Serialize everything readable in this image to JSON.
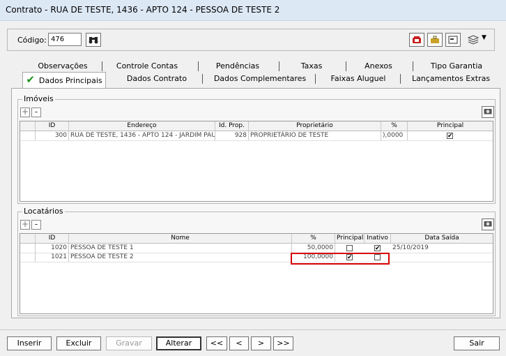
{
  "window": {
    "title": "Contrato - RUA DE TESTE, 1436 - APTO 124 - PESSOA DE TESTE 2"
  },
  "header": {
    "codigo_label": "Código:",
    "codigo_value": "476"
  },
  "tabs_row1": [
    "Observações",
    "Controle Contas",
    "Pendências",
    "Taxas",
    "Anexos",
    "Tipo Garantia"
  ],
  "tabs_row2": [
    "Dados Principais",
    "Dados Contrato",
    "Dados Complementares",
    "Faixas Aluguel",
    "Lançamentos Extras"
  ],
  "imoveis": {
    "title": "Imóveis",
    "columns": [
      "ID",
      "Endereço",
      "Id. Prop.",
      "Proprietário",
      "%",
      "Principal"
    ],
    "rows": [
      {
        "id": "300",
        "endereco": "RUA DE TESTE, 1436 - APTO 124 - JARDIM PAU",
        "id_prop": "928",
        "proprietario": "PROPRIETÁRIO DE TESTE",
        "pct": "),0000",
        "principal": true
      }
    ]
  },
  "locatarios": {
    "title": "Locatários",
    "columns": [
      "ID",
      "Nome",
      "%",
      "Principal",
      "Inativo",
      "Data Saída"
    ],
    "rows": [
      {
        "id": "1020",
        "nome": "PESSOA DE TESTE 1",
        "pct": "50,0000",
        "principal": false,
        "inativo": true,
        "data_saida": "25/10/2019"
      },
      {
        "id": "1021",
        "nome": "PESSOA DE TESTE 2",
        "pct": "100,0000",
        "principal": true,
        "inativo": false,
        "data_saida": ""
      }
    ]
  },
  "footer": {
    "inserir": "Inserir",
    "excluir": "Excluir",
    "gravar": "Gravar",
    "alterar": "Alterar",
    "first": "<<",
    "prev": "<",
    "next": ">",
    "last": ">>",
    "sair": "Sair"
  },
  "icons": {
    "search": "binoculars-icon",
    "check_mark": "✔",
    "plus": "+",
    "minus": "-"
  },
  "colors": {
    "highlight_box": "#d40000",
    "active_check": "#1a8f1a"
  }
}
